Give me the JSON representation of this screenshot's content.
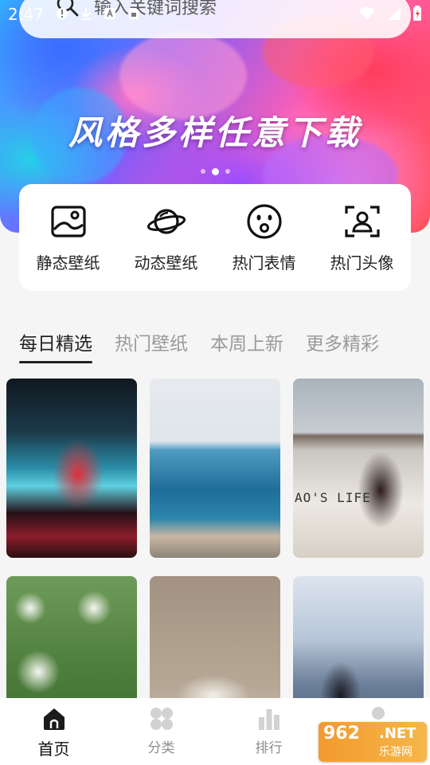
{
  "status_bar": {
    "time": "2:47"
  },
  "search": {
    "placeholder": "输入关键词搜索"
  },
  "banner": {
    "title": "风格多样任意下载",
    "dots": 3,
    "active_dot": 2
  },
  "categories": [
    {
      "label": "静态壁纸",
      "icon": "image-icon"
    },
    {
      "label": "动态壁纸",
      "icon": "planet-icon"
    },
    {
      "label": "热门表情",
      "icon": "surprised-face-icon"
    },
    {
      "label": "热门头像",
      "icon": "avatar-scan-icon"
    }
  ],
  "tabs": [
    {
      "label": "每日精选",
      "active": true
    },
    {
      "label": "热门壁纸",
      "active": false
    },
    {
      "label": "本周上新",
      "active": false
    },
    {
      "label": "更多精彩",
      "active": false
    }
  ],
  "wallpapers": [
    {
      "name": "cyberpunk-wallpaper"
    },
    {
      "name": "seaside-wallpaper"
    },
    {
      "name": "girl-hat-wallpaper",
      "sign_text": "AO'S LIFE"
    },
    {
      "name": "dandelion-wallpaper"
    },
    {
      "name": "glass-cup-wallpaper"
    },
    {
      "name": "city-skyline-wallpaper"
    }
  ],
  "bottom_nav": [
    {
      "label": "首页",
      "active": true,
      "icon": "home-icon"
    },
    {
      "label": "分类",
      "active": false,
      "icon": "category-icon"
    },
    {
      "label": "排行",
      "active": false,
      "icon": "ranking-icon"
    },
    {
      "label": "",
      "active": false,
      "icon": "profile-icon"
    }
  ],
  "watermark": {
    "num": "962",
    "net": ".NET",
    "sub": "乐游网"
  },
  "colors": {
    "accent": "#222222",
    "inactive": "#9a9a9a",
    "background": "#f5f5f5"
  }
}
